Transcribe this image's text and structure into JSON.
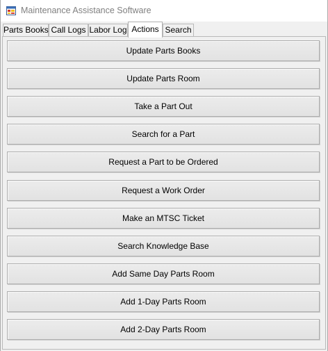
{
  "window": {
    "title": "Maintenance Assistance Software",
    "icon": "app-window-icon"
  },
  "tabs": [
    {
      "label": "Parts Books",
      "active": false
    },
    {
      "label": "Call Logs",
      "active": false
    },
    {
      "label": "Labor Log",
      "active": false
    },
    {
      "label": "Actions",
      "active": true
    },
    {
      "label": "Search",
      "active": false
    }
  ],
  "actions": [
    {
      "label": "Update Parts Books"
    },
    {
      "label": "Update Parts Room"
    },
    {
      "label": "Take a Part Out"
    },
    {
      "label": "Search for a Part"
    },
    {
      "label": "Request a Part to be Ordered"
    },
    {
      "label": "Request a Work Order"
    },
    {
      "label": "Make an MTSC Ticket"
    },
    {
      "label": "Search Knowledge Base"
    },
    {
      "label": "Add Same Day Parts Room"
    },
    {
      "label": "Add 1-Day Parts Room"
    },
    {
      "label": "Add 2-Day Parts Room"
    }
  ]
}
